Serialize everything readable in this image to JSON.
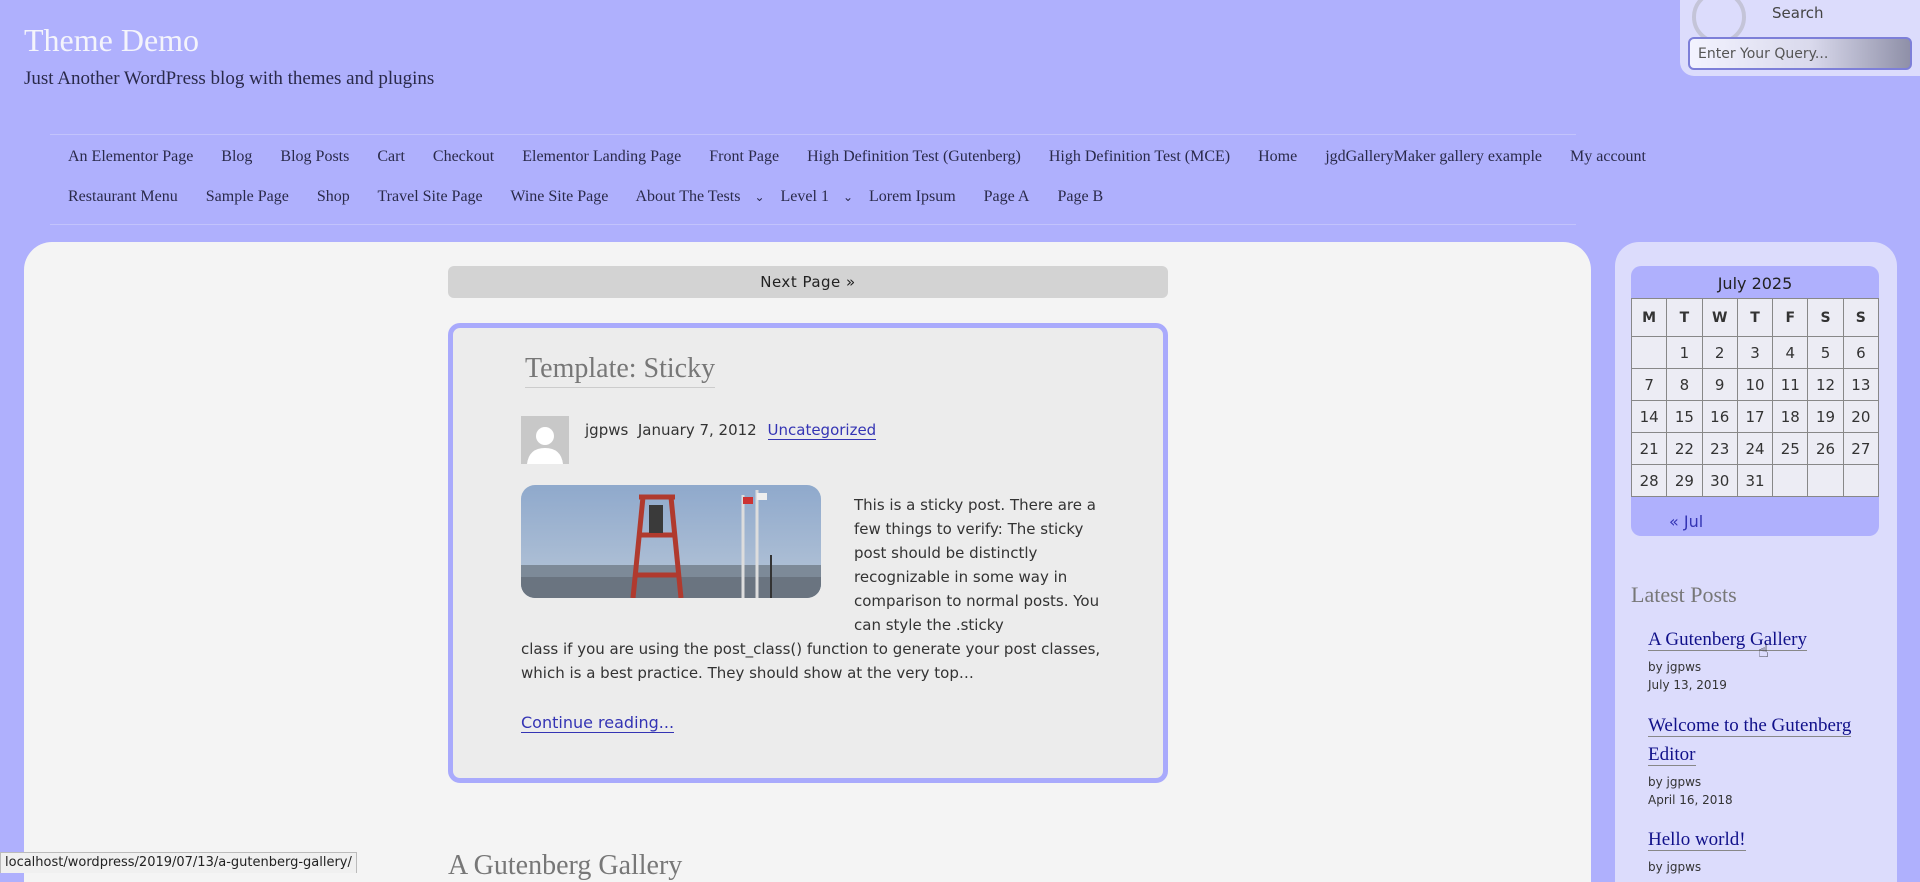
{
  "site": {
    "title": "Theme Demo",
    "tagline": "Just Another WordPress blog with themes and plugins"
  },
  "search": {
    "label": "Search",
    "placeholder": "Enter Your Query..."
  },
  "nav": {
    "row1": [
      "An Elementor Page",
      "Blog",
      "Blog Posts",
      "Cart",
      "Checkout",
      "Elementor Landing Page",
      "Front Page",
      "High Definition Test (Gutenberg)",
      "High Definition Test (MCE)",
      "Home",
      "jgdGalleryMaker gallery example",
      "My account"
    ],
    "row2": [
      "Restaurant Menu",
      "Sample Page",
      "Shop",
      "Travel Site Page",
      "Wine Site Page",
      "About The Tests",
      "Level 1",
      "Lorem Ipsum",
      "Page A",
      "Page B"
    ]
  },
  "pagination": {
    "next_label": "Next Page  »"
  },
  "post": {
    "title": "Template: Sticky",
    "author": "jgpws",
    "date": "January 7, 2012",
    "category": "Uncategorized",
    "excerpt_side": "This is a sticky post. There are a few things to verify: The sticky post should be distinctly recognizable in some way in comparison to normal posts. You can style the .sticky",
    "excerpt_full": "class if you are using the post_class() function to generate your post classes, which is a best practice. They should show at the very top…",
    "continue_label": "Continue reading..."
  },
  "next_post": {
    "title": "A Gutenberg Gallery"
  },
  "calendar": {
    "caption": "July 2025",
    "weekdays": [
      "M",
      "T",
      "W",
      "T",
      "F",
      "S",
      "S"
    ],
    "weeks": [
      [
        "",
        "1",
        "2",
        "3",
        "4",
        "5",
        "6"
      ],
      [
        "7",
        "8",
        "9",
        "10",
        "11",
        "12",
        "13"
      ],
      [
        "14",
        "15",
        "16",
        "17",
        "18",
        "19",
        "20"
      ],
      [
        "21",
        "22",
        "23",
        "24",
        "25",
        "26",
        "27"
      ],
      [
        "28",
        "29",
        "30",
        "31",
        "",
        "",
        ""
      ]
    ],
    "prev_label": "« Jul"
  },
  "latest_posts": {
    "heading": "Latest Posts",
    "items": [
      {
        "title": "A Gutenberg Gallery",
        "by": "by jgpws",
        "date": "July 13, 2019"
      },
      {
        "title": "Welcome to the Gutenberg Editor",
        "by": "by jgpws",
        "date": "April 16, 2018"
      },
      {
        "title": "Hello world!",
        "by": "by jgpws",
        "date": ""
      }
    ]
  },
  "status_bar": {
    "url": "localhost/wordpress/2019/07/13/a-gutenberg-gallery/"
  },
  "colors": {
    "background": "#afb0fd",
    "sidebar": "#dcdcfc",
    "link": "#3434b4",
    "card_border": "#a9aafc"
  }
}
